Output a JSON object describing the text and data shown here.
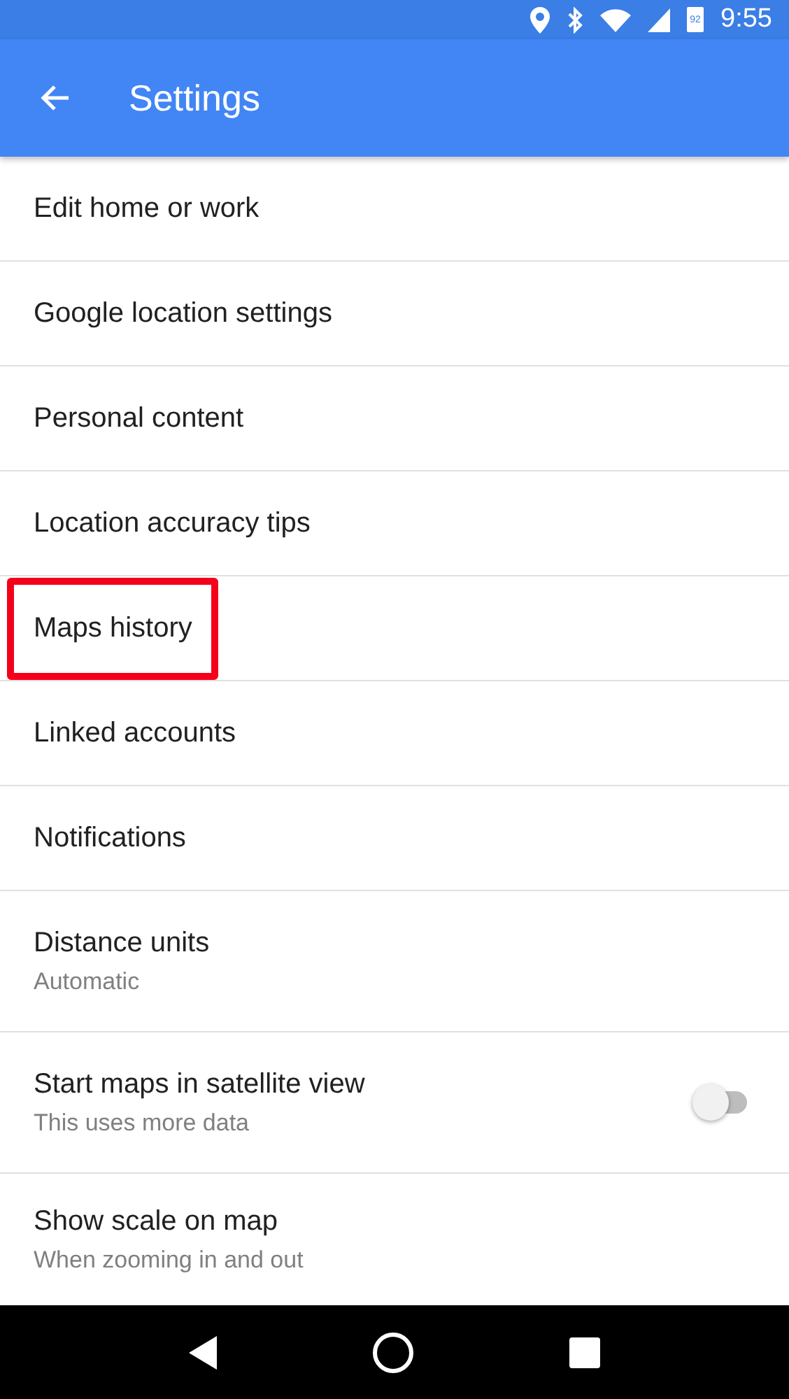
{
  "status_bar": {
    "battery": "92",
    "time": "9:55"
  },
  "app_bar": {
    "title": "Settings"
  },
  "settings": [
    {
      "kind": "plain",
      "label": "Edit home or work",
      "highlighted": false
    },
    {
      "kind": "plain",
      "label": "Google location settings",
      "highlighted": false
    },
    {
      "kind": "plain",
      "label": "Personal content",
      "highlighted": false
    },
    {
      "kind": "plain",
      "label": "Location accuracy tips",
      "highlighted": false
    },
    {
      "kind": "plain",
      "label": "Maps history",
      "highlighted": true
    },
    {
      "kind": "plain",
      "label": "Linked accounts",
      "highlighted": false
    },
    {
      "kind": "plain",
      "label": "Notifications",
      "highlighted": false
    },
    {
      "kind": "plain",
      "label": "Distance units",
      "subtitle": "Automatic",
      "highlighted": false
    },
    {
      "kind": "toggle",
      "label": "Start maps in satellite view",
      "subtitle": "This uses more data",
      "on": false,
      "highlighted": false
    },
    {
      "kind": "plain",
      "label": "Show scale on map",
      "subtitle": "When zooming in and out",
      "highlighted": false
    }
  ]
}
